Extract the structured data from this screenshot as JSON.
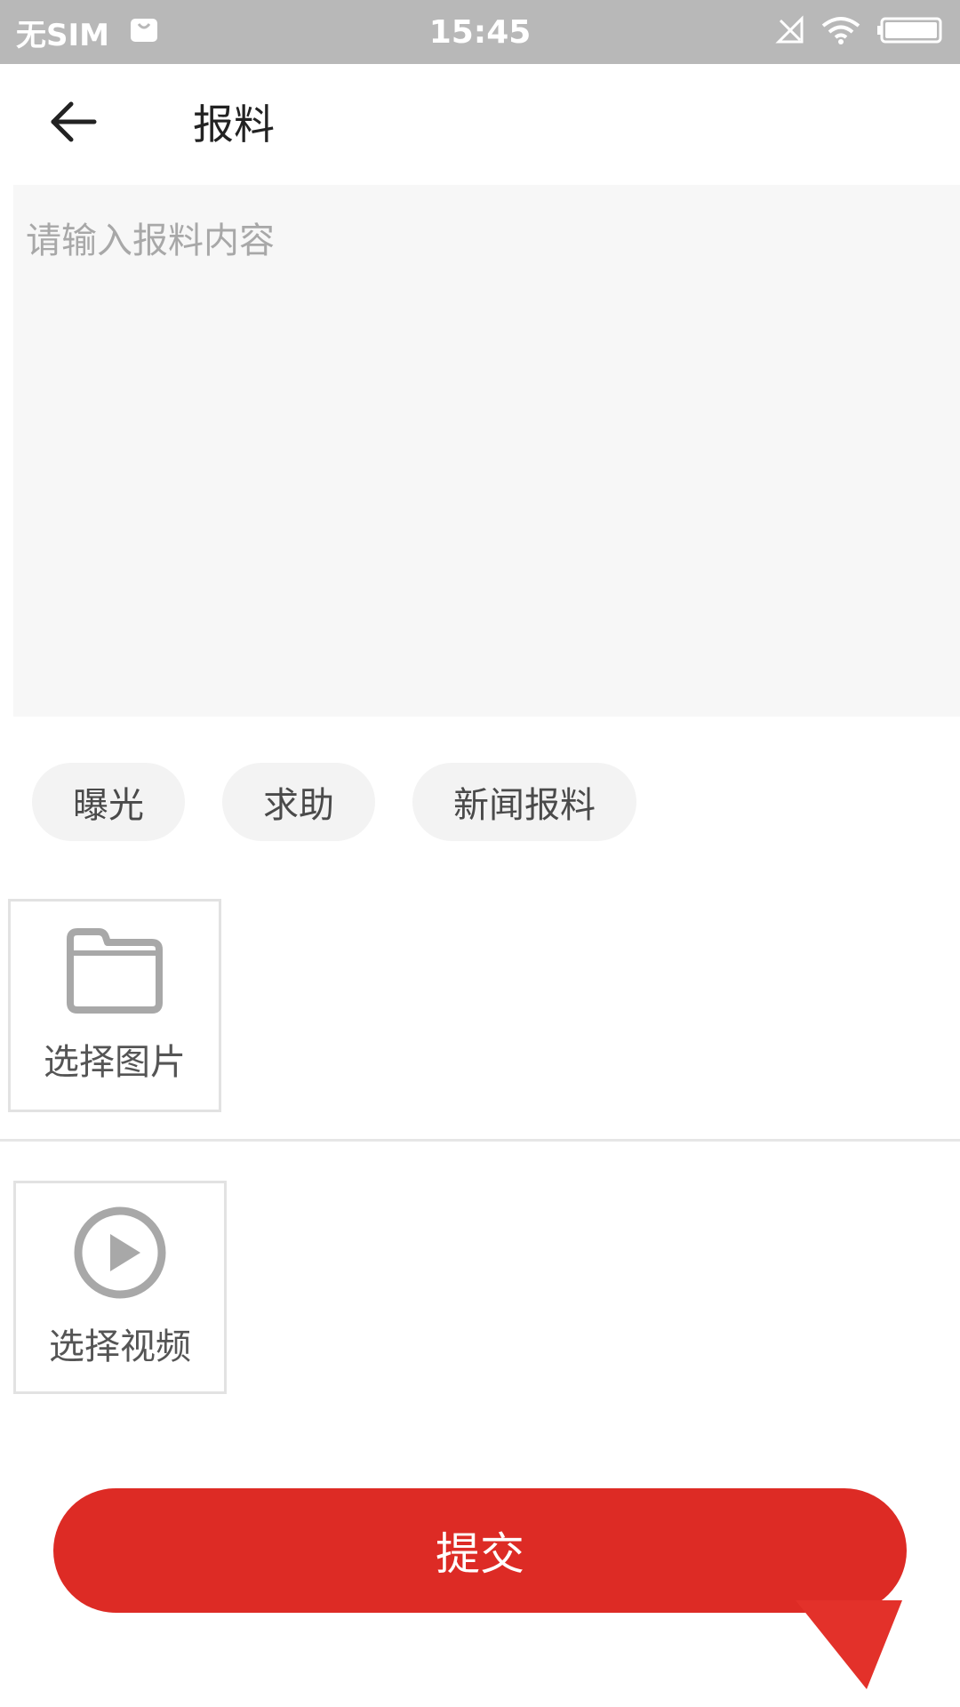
{
  "status_bar": {
    "carrier": "无SIM",
    "time": "15:45"
  },
  "header": {
    "title": "报料"
  },
  "editor": {
    "placeholder": "请输入报料内容",
    "value": ""
  },
  "tags": [
    {
      "label": "曝光"
    },
    {
      "label": "求助"
    },
    {
      "label": "新闻报料"
    }
  ],
  "pickers": {
    "image_label": "选择图片",
    "video_label": "选择视频"
  },
  "submit": {
    "label": "提交"
  },
  "colors": {
    "status_bar": "#b8b8b8",
    "accent": "#dd2b25",
    "input_bg": "#f7f7f7",
    "tag_bg": "#f3f3f3",
    "icon_gray": "#a8a8a8"
  }
}
